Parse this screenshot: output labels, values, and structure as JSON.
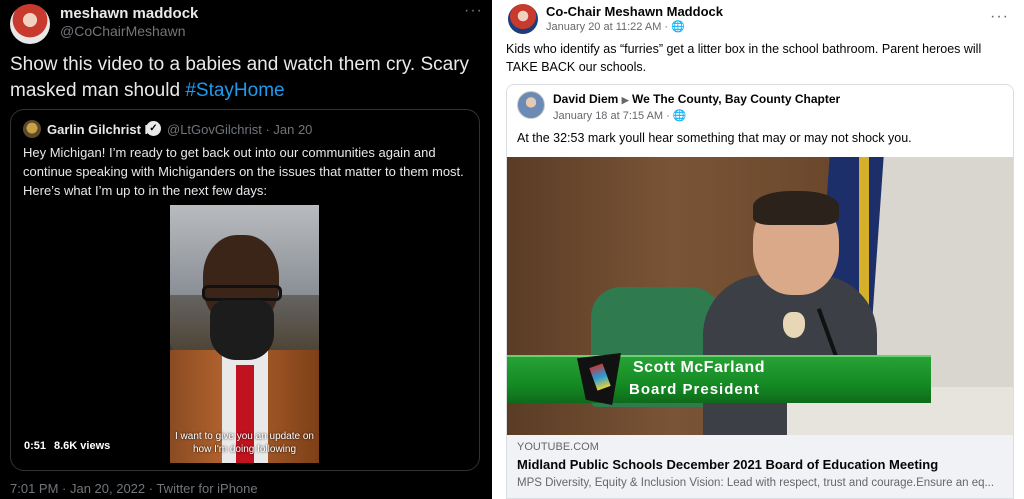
{
  "twitter": {
    "name": "meshawn maddock",
    "handle": "@CoChairMeshawn",
    "more": "···",
    "text_before": "Show this video to a babies and watch them cry. Scary masked man should ",
    "hashtag": "#StayHome",
    "quote": {
      "name": "Garlin Gilchrist II",
      "meta": "@LtGovGilchrist · Jan 20",
      "text": "Hey Michigan! I’m ready to get back out into our communities again and continue speaking with Michiganders on the issues that matter to them most. Here’s what I’m up to in the next few days:",
      "video_caption": "I want to give you an update on how I'm doing following",
      "duration": "0:51",
      "views": "8.6K views"
    },
    "footer": "7:01 PM · Jan 20, 2022 · Twitter for iPhone"
  },
  "facebook": {
    "name": "Co-Chair Meshawn Maddock",
    "date": "January 20 at 11:22 AM · 🌐",
    "more": "···",
    "text": "Kids who identify as “furries” get a litter box in the school bathroom. Parent heroes will TAKE BACK our schools.",
    "shared": {
      "author": "David Diem",
      "arrow": "▶",
      "group": "We The County, Bay County Chapter",
      "date": "January 18 at 7:15 AM · 🌐",
      "text": "At the 32:53 mark youll hear something that may or may not shock you.",
      "lower_third_name": "Scott McFarland",
      "lower_third_title": "Board  President",
      "link_domain": "YOUTUBE.COM",
      "link_title": "Midland Public Schools December 2021 Board of Education Meeting",
      "link_desc": "MPS Diversity, Equity & Inclusion Vision: Lead with respect, trust and courage.Ensure an eq..."
    }
  }
}
